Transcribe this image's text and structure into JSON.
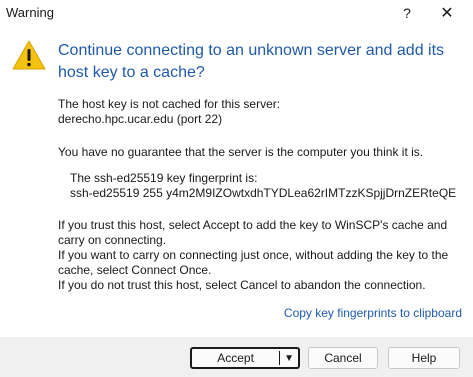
{
  "window": {
    "title": "Warning",
    "help_glyph": "?",
    "close_glyph": "✕"
  },
  "icons": {
    "warning": "warning-triangle-icon"
  },
  "colors": {
    "heading": "#1f5aa8",
    "link": "#1f5aa8",
    "warning_icon": "#f5c211"
  },
  "dialog": {
    "heading": "Continue connecting to an unknown server and add its host key to a cache?",
    "line1": "The host key is not cached for this server:",
    "line2": "derecho.hpc.ucar.edu (port 22)",
    "line3": "You have no guarantee that the server is the computer you think it is.",
    "fingerprint_label": "The ssh-ed25519 key fingerprint is:",
    "fingerprint_value": "ssh-ed25519 255 y4m2M9IZOwtxdhTYDLea62rIMTzzKSpjjDrnZERteQE",
    "para1": "If you trust this host, select Accept to add the key to WinSCP's cache and carry on connecting.",
    "para2": "If you want to carry on connecting just once, without adding the key to the cache, select Connect Once.",
    "para3": "If you do not trust this host, select Cancel to abandon the connection.",
    "copy_link": "Copy key fingerprints to clipboard"
  },
  "buttons": {
    "accept": "Accept",
    "accept_dropdown": "▼",
    "cancel": "Cancel",
    "help": "Help"
  }
}
